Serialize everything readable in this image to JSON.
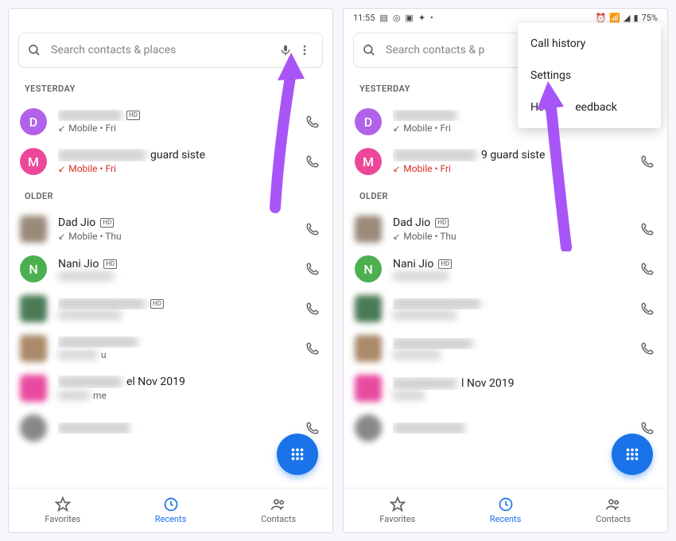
{
  "status_bar": {
    "time": "11:55",
    "battery": "75%"
  },
  "search": {
    "placeholder": "Search contacts & places",
    "placeholder_truncated": "Search contacts & p"
  },
  "sections": {
    "yesterday": "YESTERDAY",
    "older": "OLDER"
  },
  "entries": {
    "d": {
      "avatar_letter": "D",
      "avatar_color": "#b262ea",
      "sub": "Mobile • Fri",
      "missed": false
    },
    "m": {
      "avatar_letter": "M",
      "avatar_color": "#ec4899",
      "name_suffix_1": "guard siste",
      "name_suffix_2": "9 guard siste",
      "sub": "Mobile • Fri",
      "missed": true
    },
    "dad": {
      "name": "Dad Jio",
      "sub": "Mobile • Thu"
    },
    "nani": {
      "avatar_letter": "N",
      "avatar_color": "#4caf50",
      "name": "Nani Jio"
    },
    "older3": {
      "sub": ""
    },
    "older4": {
      "name": "el Nov 2019",
      "name2": "l Nov 2019"
    }
  },
  "bottom_nav": {
    "favorites": "Favorites",
    "recents": "Recents",
    "contacts": "Contacts"
  },
  "menu": {
    "call_history": "Call history",
    "settings": "Settings",
    "help": "Help & Feedback",
    "help_split_1": "Help",
    "help_split_2": "eedback"
  },
  "colors": {
    "accent": "#1a73e8",
    "arrow": "#a855f7",
    "missed": "#d93025"
  }
}
